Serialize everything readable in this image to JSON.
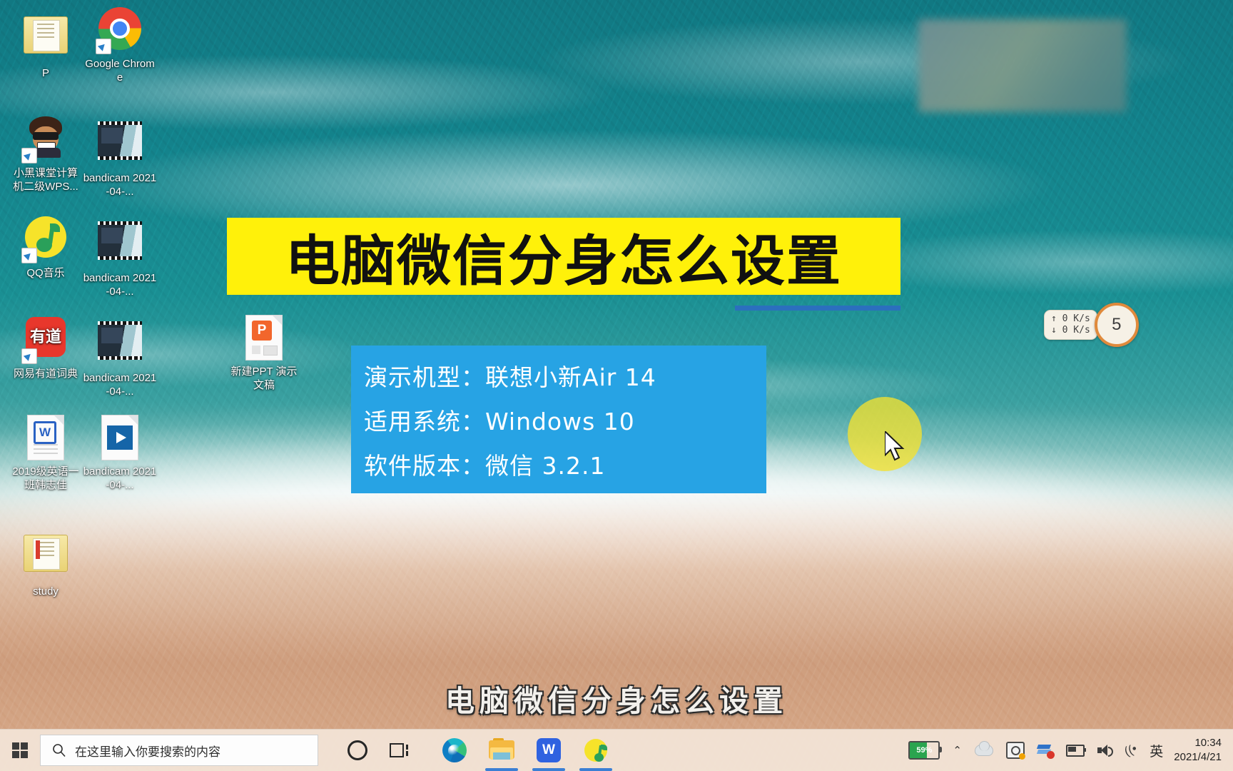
{
  "desktop": {
    "icons": [
      {
        "name": "p-folder",
        "label": "P",
        "type": "folder"
      },
      {
        "name": "google-chrome",
        "label": "Google Chrome",
        "type": "chrome"
      },
      {
        "name": "xiaohei-keting",
        "label": "小黑课堂计算机二级WPS...",
        "type": "avatar"
      },
      {
        "name": "bandicam-video-1",
        "label": "bandicam 2021-04-...",
        "type": "bandithumb"
      },
      {
        "name": "qq-music",
        "label": "QQ音乐",
        "type": "qqmusic"
      },
      {
        "name": "bandicam-video-2",
        "label": "bandicam 2021-04-...",
        "type": "bandithumb"
      },
      {
        "name": "youdao-dict",
        "label": "网易有道词典",
        "type": "youdao",
        "glyph": "有道"
      },
      {
        "name": "bandicam-video-3",
        "label": "bandicam 2021-04-...",
        "type": "bandithumb"
      },
      {
        "name": "english-doc",
        "label": "2019级英语一班韩志佳",
        "type": "worddoc",
        "glyph": "W"
      },
      {
        "name": "bandicam-video-4",
        "label": "bandicam 2021-04-...",
        "type": "videofile"
      },
      {
        "name": "new-ppt",
        "label": "新建PPT 演示文稿",
        "type": "pptfile",
        "glyph": "P"
      },
      {
        "name": "study-folder",
        "label": "study",
        "type": "folder-study"
      }
    ]
  },
  "overlay": {
    "title": "电脑微信分身怎么设置",
    "info_lines": [
      "演示机型：联想小新Air 14",
      "适用系统：Windows 10",
      "软件版本：微信 3.2.1"
    ],
    "subtitle": "电脑微信分身怎么设置",
    "colors": {
      "title_banner_bg": "#FFF10A",
      "title_text": "#111111",
      "title_underline": "#2B6FBE",
      "info_box_bg": "#27A3E4",
      "info_text": "#FFFFFF",
      "cursor_highlight": "#F3E22F"
    }
  },
  "net_widget": {
    "upload": "↑ 0  K/s",
    "download": "↓ 0  K/s",
    "gauge": "5"
  },
  "taskbar": {
    "search_placeholder": "在这里输入你要搜索的内容",
    "buttons": [
      {
        "name": "cortana-button",
        "label": "Cortana"
      },
      {
        "name": "task-view-button",
        "label": "任务视图"
      }
    ],
    "apps": [
      {
        "name": "microsoft-edge",
        "label": "Microsoft Edge",
        "open": false
      },
      {
        "name": "file-explorer",
        "label": "文件资源管理器",
        "open": true
      },
      {
        "name": "wps-office",
        "label": "WPS Office",
        "open": true,
        "glyph": "W"
      },
      {
        "name": "qq-music-taskbar",
        "label": "QQ音乐",
        "open": true
      }
    ],
    "tray": {
      "battery_percent": "59%",
      "battery_level": 59,
      "overflow_chevron": "⌃",
      "ime_label": "英",
      "wifi_label": "((•",
      "items": [
        {
          "name": "onedrive-tray-icon",
          "label": "OneDrive"
        },
        {
          "name": "screenshot-tray-icon",
          "label": "截图工具"
        },
        {
          "name": "stack-tray-icon",
          "label": "驱动管理"
        },
        {
          "name": "battery-tray-icon",
          "label": "电池"
        },
        {
          "name": "volume-tray-icon",
          "label": "音量"
        },
        {
          "name": "network-tray-icon",
          "label": "网络"
        }
      ]
    },
    "clock": {
      "time": "10:34",
      "date": "2021/4/21"
    }
  }
}
